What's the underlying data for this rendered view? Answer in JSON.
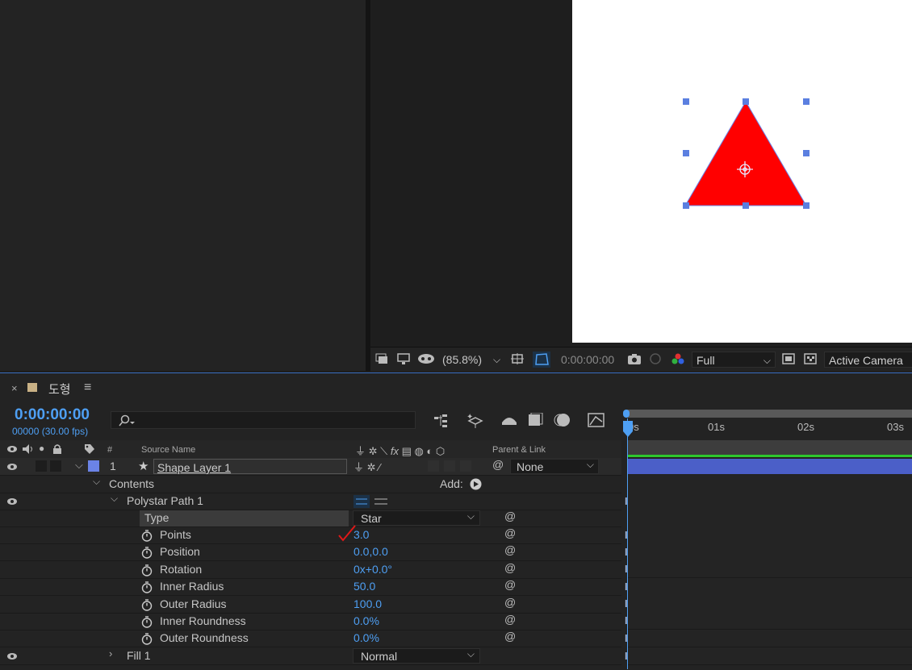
{
  "viewer": {
    "zoom": "(85.8%)",
    "timecode": "0:00:00:00",
    "resolution": "Full",
    "camera": "Active Camera",
    "shape_fill": "#ff0000",
    "handle_color": "#5b7fe0"
  },
  "timeline": {
    "close": "×",
    "tab_name": "도형",
    "menu": "≡",
    "current_time": "0:00:00:00",
    "fps": "00000 (30.00 fps)",
    "search_placeholder": "",
    "columns": {
      "num": "#",
      "source_name": "Source Name",
      "parent_link": "Parent & Link"
    },
    "ruler": [
      "0s",
      "01s",
      "02s",
      "03s"
    ],
    "layer": {
      "number": "1",
      "name": "Shape Layer 1",
      "parent": "None"
    },
    "contents_label": "Contents",
    "add_label": "Add:",
    "polystar": "Polystar Path 1",
    "properties": [
      {
        "name": "Type",
        "value": "Star"
      },
      {
        "name": "Points",
        "value": "3.0"
      },
      {
        "name": "Position",
        "value": "0.0,0.0"
      },
      {
        "name": "Rotation",
        "value": "0x+0.0°"
      },
      {
        "name": "Inner Radius",
        "value": "50.0"
      },
      {
        "name": "Outer Radius",
        "value": "100.0"
      },
      {
        "name": "Inner Roundness",
        "value": "0.0%"
      },
      {
        "name": "Outer Roundness",
        "value": "0.0%"
      }
    ],
    "fill": {
      "name": "Fill 1",
      "mode": "Normal"
    },
    "accent": "#4e9ff3",
    "layer_bar": "#4b5fc8",
    "checkmark_color": "#e01818"
  }
}
